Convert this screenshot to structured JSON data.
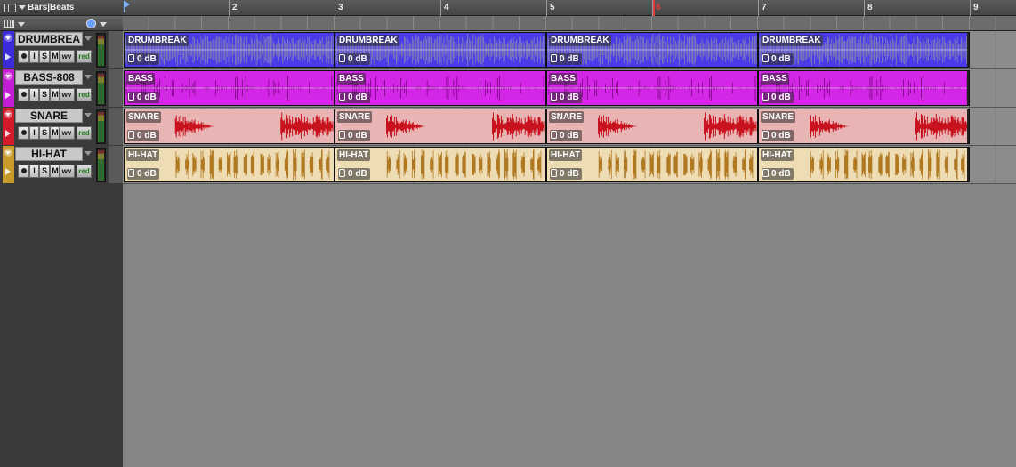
{
  "ruler": {
    "name": "Bars|Beats",
    "bars": [
      "2",
      "3",
      "4",
      "5",
      "6",
      "7",
      "8",
      "9"
    ],
    "highlighted_bar": "6"
  },
  "button_labels": {
    "input": "I",
    "solo": "S",
    "mute": "M",
    "view": "wv",
    "timeline": "red"
  },
  "tracks": [
    {
      "name": "DRUMBREA",
      "color": "#3b2bd8",
      "wave": "#0a0a8a",
      "bg": "#4a3be8",
      "clips": [
        {
          "label": "DRUMBREAK",
          "gain": "0 dB"
        },
        {
          "label": "DRUMBREAK",
          "gain": "0 dB"
        },
        {
          "label": "DRUMBREAK",
          "gain": "0 dB"
        },
        {
          "label": "DRUMBREAK",
          "gain": "0 dB"
        }
      ]
    },
    {
      "name": "BASS-808",
      "color": "#c61ed6",
      "wave": "#6a0070",
      "bg": "#d326e6",
      "clips": [
        {
          "label": "BASS",
          "gain": "0 dB"
        },
        {
          "label": "BASS",
          "gain": "0 dB"
        },
        {
          "label": "BASS",
          "gain": "0 dB"
        },
        {
          "label": "BASS",
          "gain": "0 dB"
        }
      ]
    },
    {
      "name": "SNARE",
      "color": "#d21a2a",
      "wave": "#c8121e",
      "bg": "#e8b4b4",
      "clips": [
        {
          "label": "SNARE",
          "gain": "0 dB"
        },
        {
          "label": "SNARE",
          "gain": "0 dB"
        },
        {
          "label": "SNARE",
          "gain": "0 dB"
        },
        {
          "label": "SNARE",
          "gain": "0 dB"
        }
      ]
    },
    {
      "name": "HI-HAT",
      "color": "#c89a2a",
      "wave": "#b07820",
      "bg": "#eedcb4",
      "clips": [
        {
          "label": "HI-HAT",
          "gain": "0 dB"
        },
        {
          "label": "HI-HAT",
          "gain": "0 dB"
        },
        {
          "label": "HI-HAT",
          "gain": "0 dB"
        },
        {
          "label": "HI-HAT",
          "gain": "0 dB"
        }
      ]
    }
  ]
}
